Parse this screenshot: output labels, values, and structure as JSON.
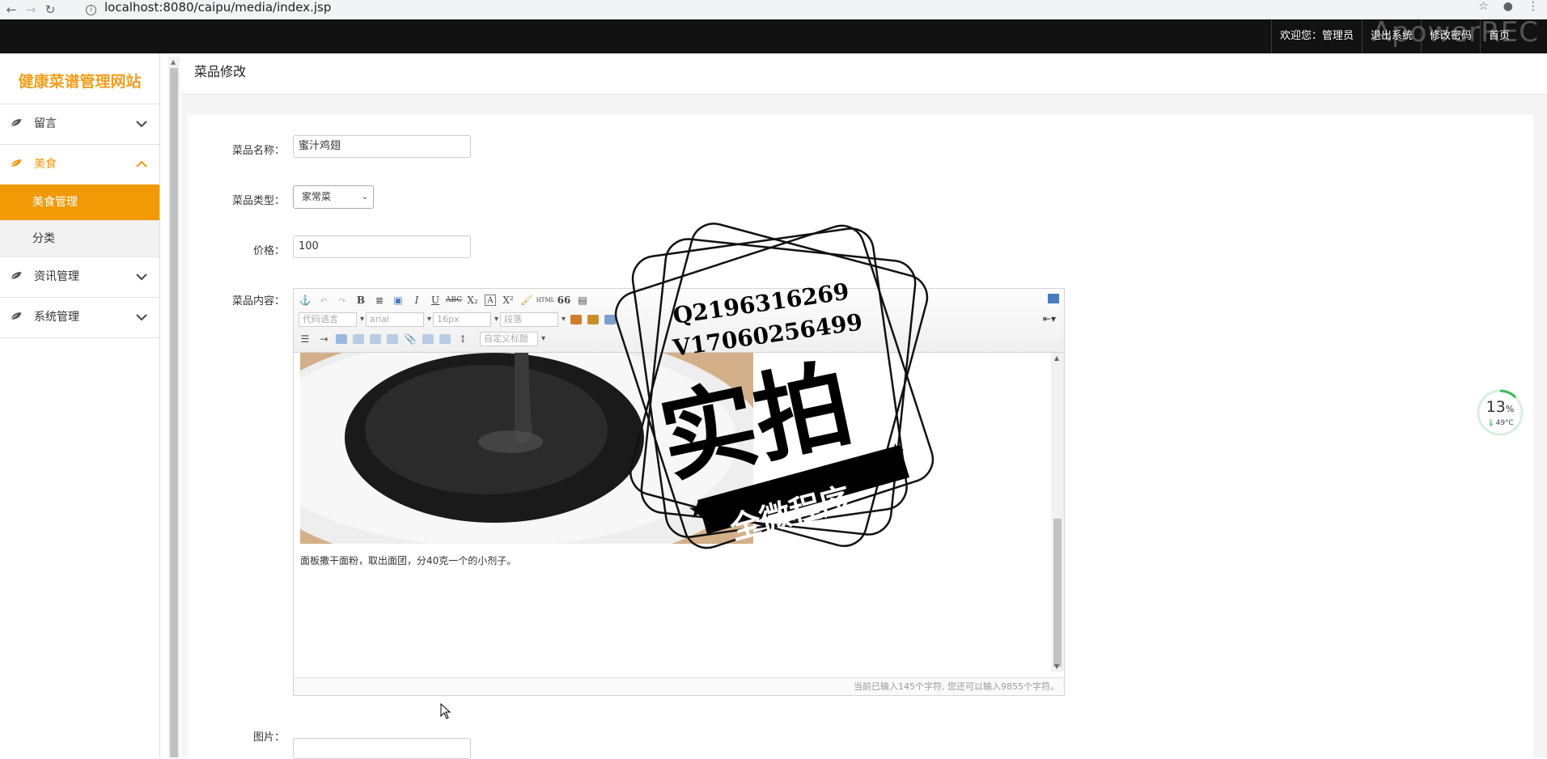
{
  "browser": {
    "url": "localhost:8080/caipu/media/index.jsp"
  },
  "header": {
    "links": [
      "欢迎您：管理员",
      "退出系统",
      "修改密码",
      "首页"
    ],
    "recorder_watermark": "ApowerREC"
  },
  "sidebar": {
    "brand": "健康菜谱管理网站",
    "items": [
      {
        "label": "留言",
        "expanded": false
      },
      {
        "label": "美食",
        "expanded": true,
        "children": [
          {
            "label": "美食管理",
            "active": true
          },
          {
            "label": "分类",
            "active": false
          }
        ]
      },
      {
        "label": "资讯管理",
        "expanded": false
      },
      {
        "label": "系统管理",
        "expanded": false
      }
    ],
    "accent_color": "#f29a05"
  },
  "page": {
    "title": "菜品修改"
  },
  "form": {
    "name_label": "菜品名称：",
    "name_value": "蜜汁鸡翅",
    "type_label": "菜品类型：",
    "type_value": "家常菜",
    "price_label": "价格：",
    "price_value": "100",
    "content_label": "菜品内容：",
    "image_label": "图片："
  },
  "editor": {
    "selects": [
      "代码语言",
      "arial",
      "16px",
      "段落",
      "自定义标题"
    ],
    "body_text": "面板撒干面粉，取出面团，分40克一个的小剂子。",
    "status": "当前已输入145个字符, 您还可以输入9855个字符。"
  },
  "stamp": {
    "qq": "Q2196316269",
    "wechat": "V17060256499",
    "big_text": "实拍",
    "banner": "全微程序"
  },
  "widget": {
    "percent": "13",
    "percent_unit": "%",
    "temperature": "49°C"
  }
}
